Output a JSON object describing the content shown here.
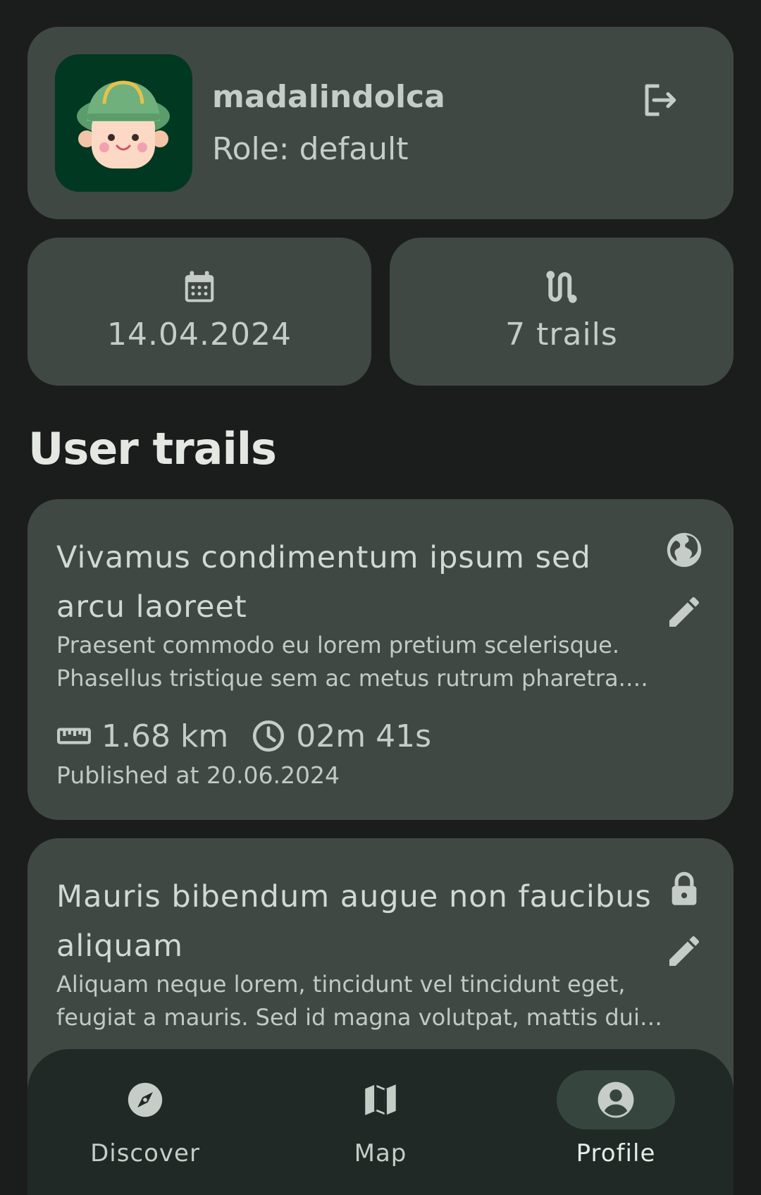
{
  "profile": {
    "username": "madalindolca",
    "role_prefix": "Role: ",
    "role_value": "default",
    "avatar": "hiker-avatar"
  },
  "stats": {
    "join_date": "14.04.2024",
    "trails_count": "7 trails"
  },
  "section_title": "User trails",
  "trails": [
    {
      "title": "Vivamus condimentum ipsum sed arcu laoreet",
      "description": "Praesent commodo eu lorem pretium scelerisque. Phasellus tristique sem ac metus rutrum pharetra. Nam ut sapien in elit tincidunt porta.",
      "distance": "1.68 km",
      "duration": "02m 41s",
      "published_prefix": "Published at ",
      "published_date": "20.06.2024",
      "visibility_icon": "globe-icon"
    },
    {
      "title": "Mauris bibendum augue non faucibus aliquam",
      "description": "Aliquam neque lorem, tincidunt vel tincidunt eget, feugiat a mauris. Sed id magna volutpat, mattis dui vitae, aliquet nisl.",
      "visibility_icon": "lock-icon"
    }
  ],
  "nav": [
    {
      "label": "Discover",
      "icon": "compass-icon",
      "active": false
    },
    {
      "label": "Map",
      "icon": "map-icon",
      "active": false
    },
    {
      "label": "Profile",
      "icon": "account-circle-icon",
      "active": true
    }
  ],
  "colors": {
    "background": "#1b1d1c",
    "card": "#404844",
    "nav_bar": "#202925",
    "active_pill": "#36463e",
    "avatar_bg": "#003822"
  }
}
